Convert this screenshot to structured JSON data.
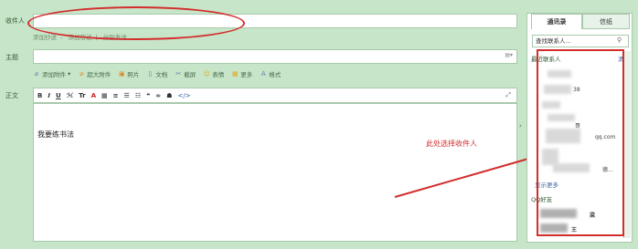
{
  "form": {
    "to_label": "收件人",
    "subject_label": "主题",
    "body_label": "正文",
    "to_value": "",
    "subject_value": "",
    "sub_links": [
      "添加抄送",
      "添加密送",
      "分别发送"
    ]
  },
  "toolbar": {
    "items": [
      "添加附件",
      "超大附件",
      "照片",
      "文档",
      "截屏",
      "表情",
      "更多",
      "格式"
    ]
  },
  "format_bar": {
    "buttons": [
      "B",
      "I",
      "U",
      "ℋ",
      "Tr",
      "A",
      "▦",
      "≡",
      "☰",
      "☷",
      "❝",
      "∞",
      "☗",
      "</>"
    ]
  },
  "editor": {
    "body_text": "我要练书法"
  },
  "annotation": {
    "note": "此处选择收件人",
    "color": "#d32d2d"
  },
  "sidebar": {
    "tabs": [
      "通讯录",
      "信纸"
    ],
    "search_placeholder": "查找联系人...",
    "recent_label": "最近联系人",
    "clear_label": "清空",
    "contact_snippets": [
      "38",
      "哥",
      "qq.com",
      "德..."
    ],
    "more_label": "显示更多",
    "qq_friends_label": "QQ好友",
    "qq_snippets": [
      "梁",
      "王"
    ]
  }
}
